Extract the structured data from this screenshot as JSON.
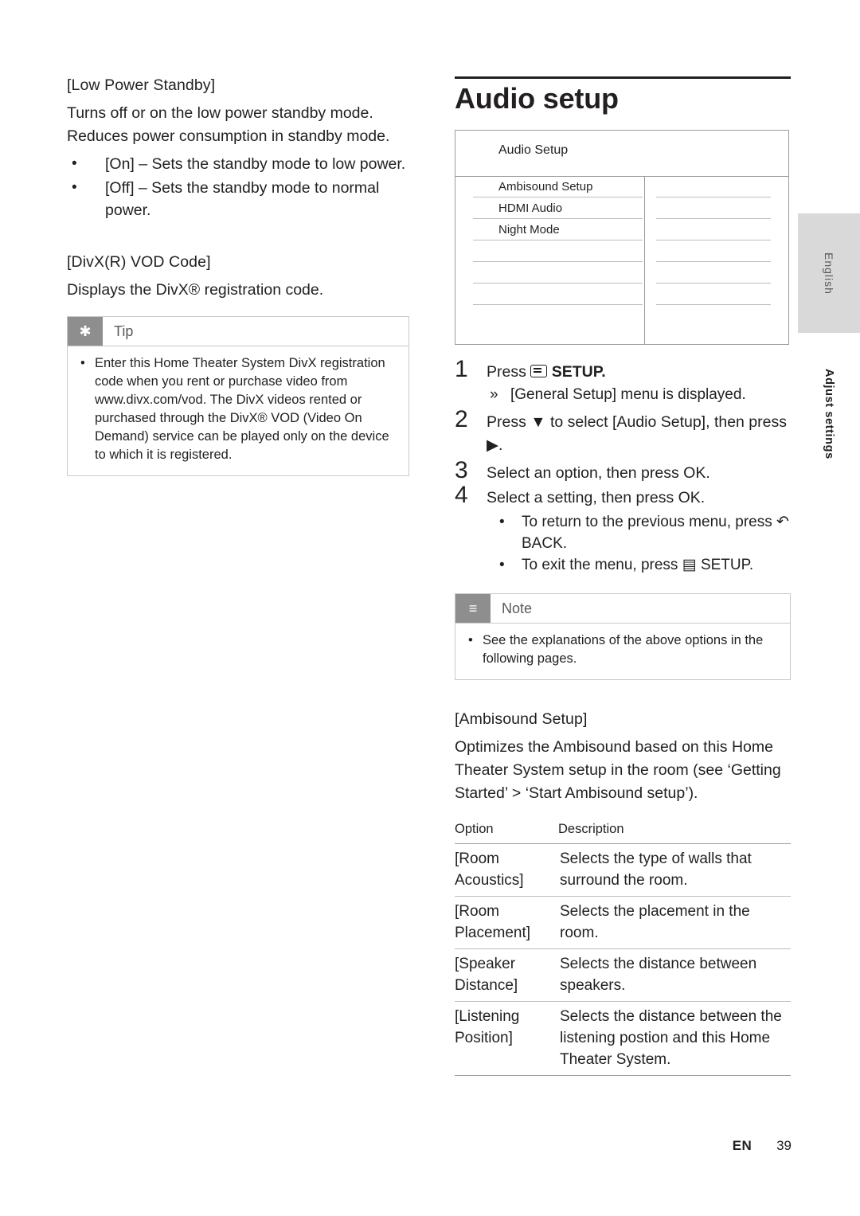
{
  "left": {
    "section1": {
      "heading": "[Low Power Standby]",
      "paragraph": "Turns off or on the low power standby mode. Reduces power consumption in standby mode.",
      "bullets": [
        "[On] – Sets the standby mode to low power.",
        "[Off] – Sets the standby mode to normal power."
      ]
    },
    "section2": {
      "heading": "[DivX(R) VOD Code]",
      "paragraph": "Displays the DivX® registration code."
    },
    "tip": {
      "title": "Tip",
      "badge_icon": "asterisk-icon",
      "items": [
        "Enter this Home Theater System DivX registration code when you rent or purchase video from www.divx.com/vod. The DivX videos rented or purchased through the DivX® VOD (Video On Demand) service can be played only on the device to which it is registered."
      ]
    }
  },
  "right": {
    "chapter_title": "Audio setup",
    "screen": {
      "title": "Audio Setup",
      "rows": [
        "Ambisound Setup",
        "HDMI Audio",
        "Night Mode",
        "",
        "",
        "",
        ""
      ]
    },
    "steps": [
      {
        "num": "1",
        "text_before": "Press",
        "icon": "setup-button-icon",
        "text_after": "SETUP.",
        "sub": "[General Setup] menu is displayed.",
        "sub_marker": "»"
      },
      {
        "num": "2",
        "text": "Press ▼ to select [Audio Setup], then press ▶."
      },
      {
        "num": "3",
        "text": "Select an option, then press OK."
      },
      {
        "num": "4",
        "text": "Select a setting, then press OK.",
        "bullets": [
          "To return to the previous menu, press ↶ BACK.",
          "To exit the menu, press ▤ SETUP."
        ]
      }
    ],
    "note": {
      "title": "Note",
      "badge_icon": "lines-icon",
      "items": [
        "See the explanations of the above options in the following pages."
      ]
    },
    "ambisound": {
      "heading": "[Ambisound Setup]",
      "paragraph": "Optimizes the Ambisound based on this Home Theater System setup in the room (see ‘Getting Started’ > ‘Start Ambisound setup’)."
    },
    "table": {
      "headers": [
        "Option",
        "Description"
      ],
      "rows": [
        {
          "option": "[Room Acoustics]",
          "description": "Selects the type of walls that surround the room."
        },
        {
          "option": "[Room Placement]",
          "description": "Selects the placement in the room."
        },
        {
          "option": "[Speaker Distance]",
          "description": "Selects the distance between speakers."
        },
        {
          "option": "[Listening Position]",
          "description": "Selects the distance between the listening postion and this Home Theater System."
        }
      ]
    }
  },
  "tabs": {
    "english": "English",
    "adjust": "Adjust settings"
  },
  "footer": {
    "locale": "EN",
    "page": "39"
  }
}
